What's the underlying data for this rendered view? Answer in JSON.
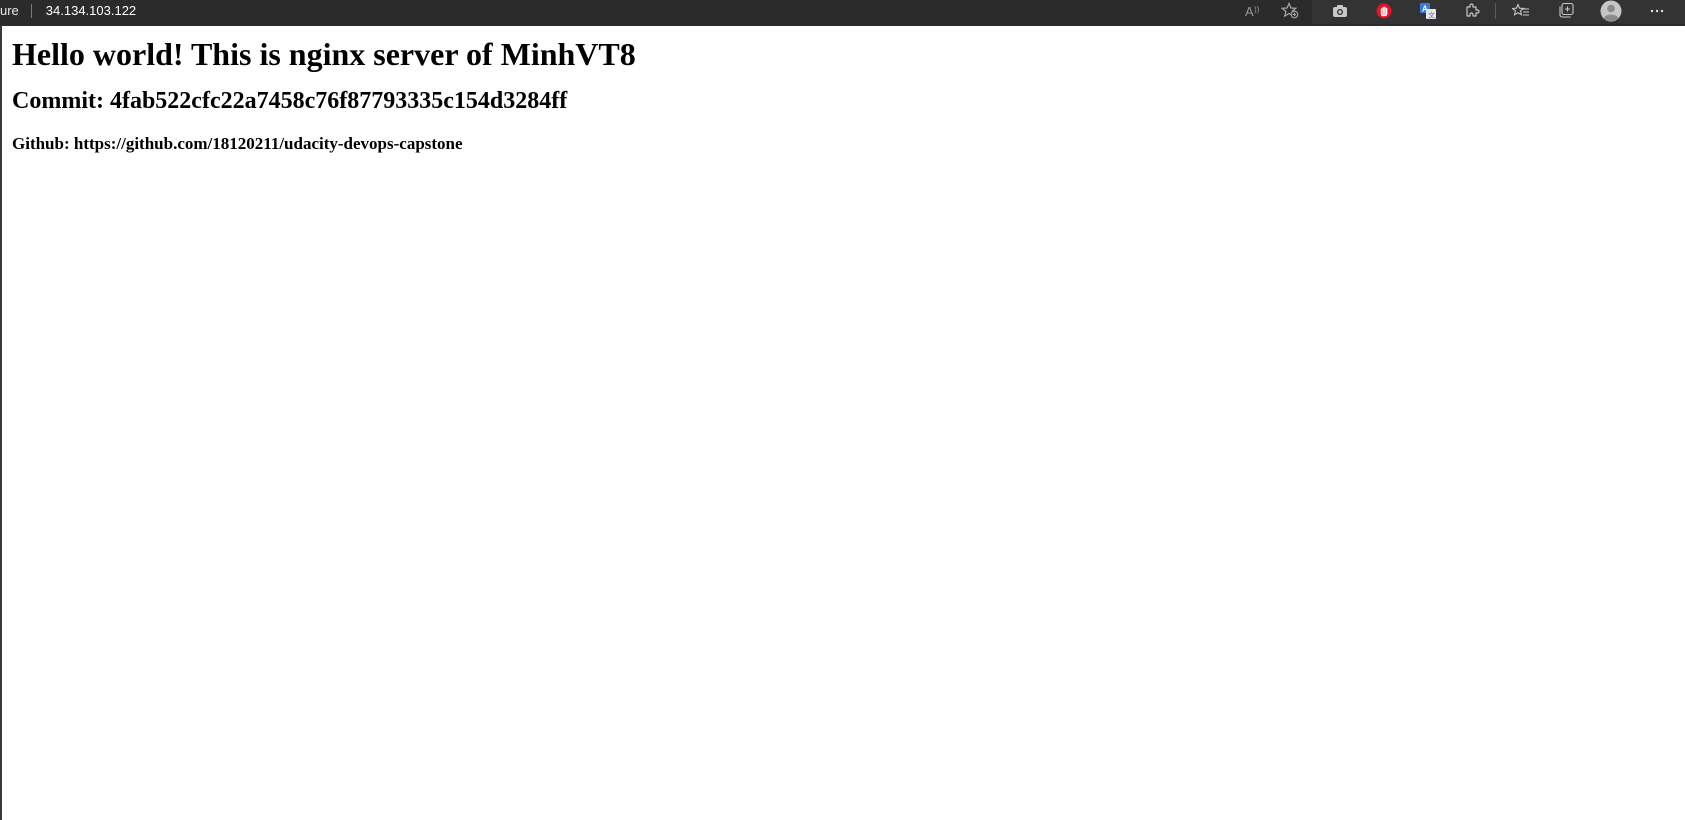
{
  "browser": {
    "security_label": "ure",
    "url": "34.134.103.122",
    "icons": [
      "read-aloud-icon",
      "add-favorite-icon",
      "screenshot-icon",
      "adblock-icon",
      "translate-icon",
      "extensions-icon",
      "favorites-icon",
      "collections-icon",
      "profile-icon",
      "more-icon"
    ]
  },
  "page": {
    "heading": "Hello world! This is nginx server of MinhVT8",
    "commit": "Commit: 4fab522cfc22a7458c76f87793335c154d3284ff",
    "github": "Github: https://github.com/18120211/udacity-devops-capstone"
  },
  "colors": {
    "toolbar_bg": "#2b2b2b",
    "adblock_red": "#e81123",
    "translate_blue": "#3b78e7"
  }
}
